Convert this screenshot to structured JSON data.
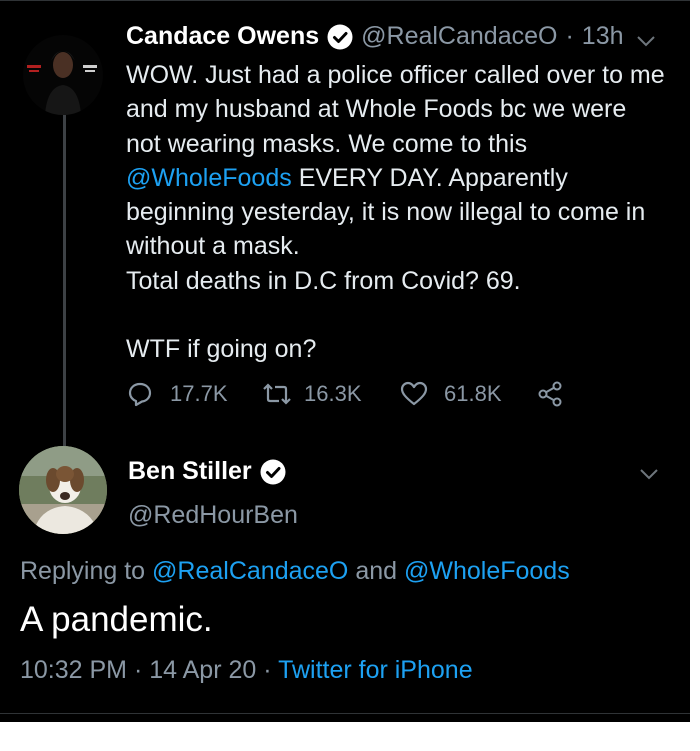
{
  "tweet": {
    "author_name": "Candace Owens",
    "handle": "@RealCandaceO",
    "separator": "·",
    "time": "13h",
    "text_part1": "WOW. Just had a police officer called over to me and my husband at Whole Foods bc we were not wearing masks. We come to this",
    "mention": "@WholeFoods",
    "text_part2": "EVERY DAY. Apparently beginning yesterday, it is now illegal to come in without a mask.",
    "text_line3": "Total deaths in D.C from Covid? 69.",
    "text_line4": "WTF if going on?",
    "replies": "17.7K",
    "retweets": "16.3K",
    "likes": "61.8K",
    "icons": {
      "reply": "reply-icon",
      "retweet": "retweet-icon",
      "like": "heart-icon",
      "share": "share-icon",
      "verified": "verified-badge-icon",
      "more": "chevron-down-icon"
    }
  },
  "reply": {
    "author_name": "Ben Stiller",
    "handle": "@RedHourBen",
    "replying_prefix": "Replying to",
    "replying_user1": "@RealCandaceO",
    "replying_and": "and",
    "replying_user2": "@WholeFoods",
    "text": "A pandemic.",
    "time": "10:32 PM",
    "separator": "·",
    "date": "14 Apr 20",
    "source": "Twitter for iPhone"
  },
  "colors": {
    "background": "#000000",
    "text_primary": "#e6ecf0",
    "text_secondary": "#8b98a5",
    "link": "#1da1f2",
    "divider": "#2f3336"
  }
}
